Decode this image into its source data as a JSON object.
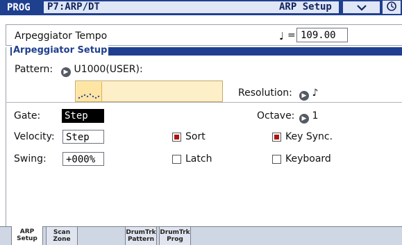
{
  "header": {
    "mode": "PROG",
    "program": "P7:ARP/DT",
    "page_title": "ARP Setup",
    "menu_glyph": "⌄",
    "circle_glyph": "⌚"
  },
  "tempo": {
    "label": "Arpeggiator Tempo",
    "note": "♩",
    "equals": "=",
    "value": "109.00"
  },
  "arp": {
    "section_title": "Arpeggiator Setup",
    "pattern_label": "Pattern:",
    "pattern_value": "U1000(USER):",
    "resolution_label": "Resolution:",
    "resolution_value": "♪",
    "gate_label": "Gate:",
    "gate_value": "Step",
    "octave_label": "Octave:",
    "octave_value": "1",
    "velocity_label": "Velocity:",
    "velocity_value": "Step",
    "swing_label": "Swing:",
    "swing_value": "+000%",
    "sort_label": "Sort",
    "sort_checked": true,
    "latch_label": "Latch",
    "latch_checked": false,
    "keysync_label": "Key Sync.",
    "keysync_checked": true,
    "keyboard_label": "Keyboard",
    "keyboard_checked": false
  },
  "tabs": [
    {
      "line1": "ARP",
      "line2": "Setup",
      "active": true
    },
    {
      "line1": "Scan",
      "line2": "Zone",
      "active": false
    },
    {
      "line1": "DrumTrk",
      "line2": "Pattern",
      "active": false
    },
    {
      "line1": "DrumTrk",
      "line2": "Prog",
      "active": false
    }
  ],
  "colors": {
    "header_bg": "#1f3f8f",
    "accent": "#1f3f8f",
    "checkbox_on": "#b01515",
    "pattern_bg": "#fdefc8"
  }
}
